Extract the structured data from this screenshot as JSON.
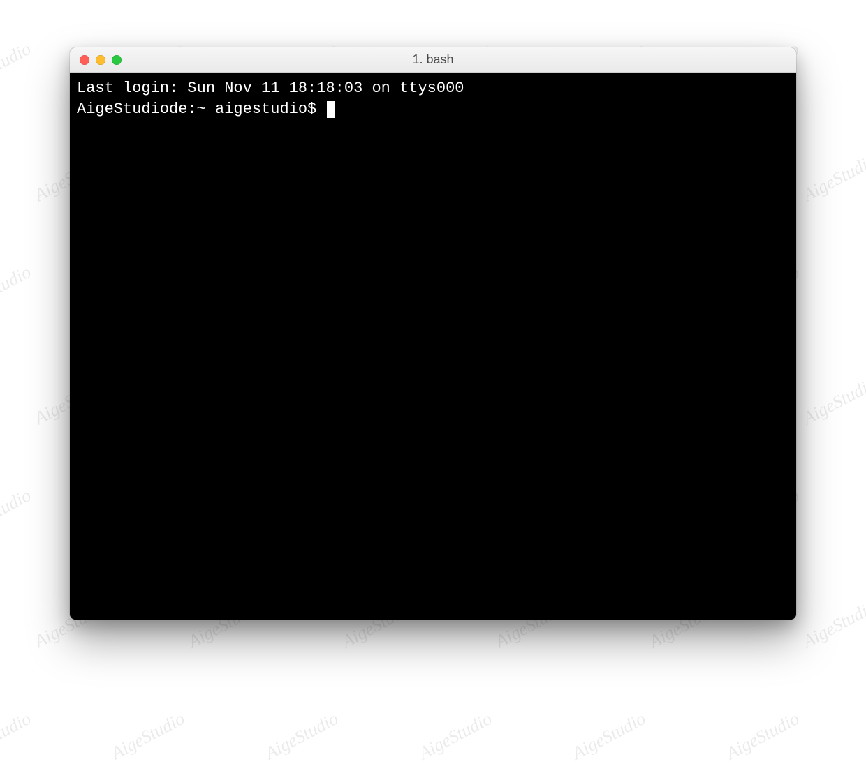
{
  "window": {
    "title": "1. bash"
  },
  "terminal": {
    "last_login_line": "Last login: Sun Nov 11 18:18:03 on ttys000",
    "prompt": "AigeStudiode:~ aigestudio$ "
  },
  "watermark": {
    "text": "AigeStudio"
  },
  "colors": {
    "close": "#ff5f57",
    "minimize": "#febc2e",
    "zoom": "#28c840",
    "terminal_bg": "#000000",
    "terminal_fg": "#ffffff",
    "titlebar_top": "#f6f6f6",
    "titlebar_bottom": "#eaeaea"
  }
}
